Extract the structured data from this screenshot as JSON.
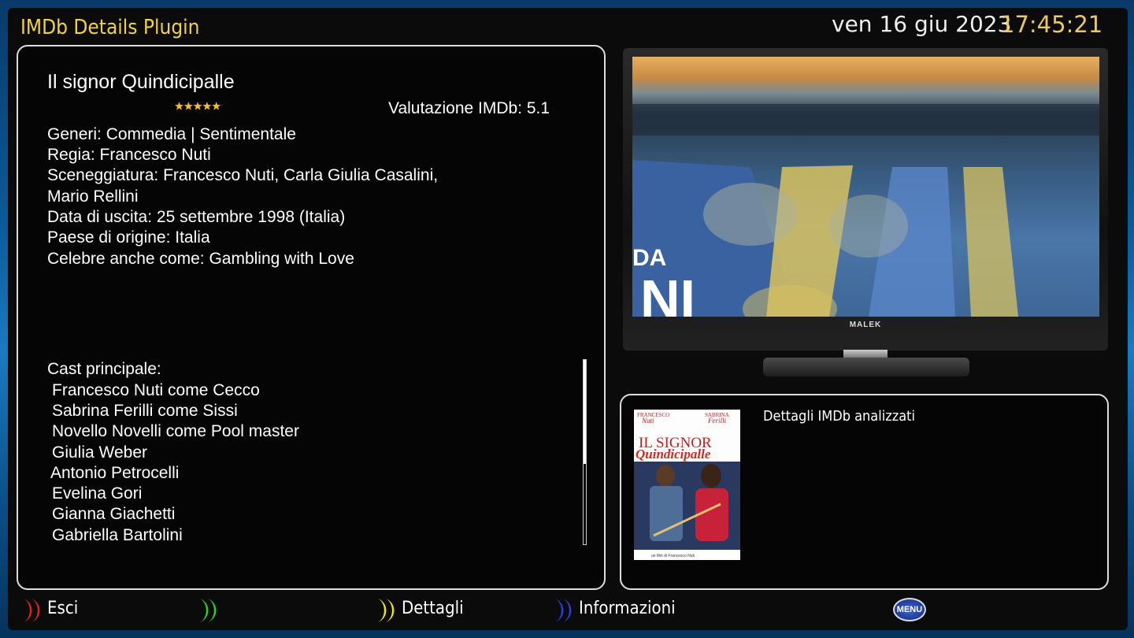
{
  "header": {
    "title": "IMDb Details Plugin",
    "date": "ven 16 giu 2023",
    "time": "17:45:21"
  },
  "movie": {
    "title": "Il signor Quindicipalle",
    "rating_text": "Valutazione IMDb: 5.1",
    "rating_value": 5.1,
    "rating_max": 10,
    "info": [
      "Generi: Commedia | Sentimentale",
      "Regia: Francesco Nuti",
      "Sceneggiatura: Francesco Nuti, Carla Giulia Casalini,",
      "Mario Rellini",
      "Data di uscita: 25 settembre 1998 (Italia)",
      "Paese di origine: Italia",
      "Celebre anche come: Gambling with Love"
    ],
    "cast_title": "Cast principale:",
    "cast": [
      "Francesco Nuti come Cecco",
      "Sabrina Ferilli come Sissi",
      "Novello Novelli come Pool master",
      "Giulia Weber",
      "Antonio Petrocelli",
      "Evelina Gori",
      "Gianna Giachetti",
      "Gabriella Bartolini"
    ]
  },
  "tv": {
    "brand": "MALEK",
    "screen_text_1": "DA",
    "screen_text_2": "NI"
  },
  "poster": {
    "actor_1_first": "FRANCESCO",
    "actor_1_last": "Nuti",
    "actor_2_first": "SABRINA",
    "actor_2_last": "Ferilli",
    "title_line_1": "IL SIGNOR",
    "title_line_2": "Quindicipalle",
    "credit": "un film di Francesco Nuti"
  },
  "status": {
    "text": "Dettagli IMDb analizzati"
  },
  "keys": {
    "red": "Esci",
    "green": "",
    "yellow": "Dettagli",
    "blue": "Informazioni",
    "menu": "MENU"
  },
  "colors": {
    "title": "#f2d33a",
    "time": "#e9c86a",
    "red_key": "#e0201c",
    "green_key": "#22d22a",
    "yellow_key": "#f0e020",
    "blue_key": "#2b3fd8"
  }
}
